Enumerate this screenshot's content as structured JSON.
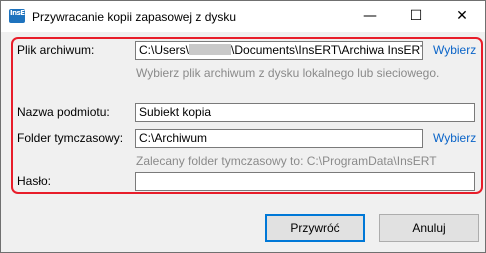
{
  "window": {
    "title": "Przywracanie kopii zapasowej z dysku",
    "icon_text": "InsERT",
    "controls": {
      "minimize": "—",
      "maximize": "☐",
      "close": "✕"
    }
  },
  "form": {
    "archive": {
      "label": "Plik archiwum:",
      "value_prefix": "C:\\Users\\",
      "value_suffix": "\\Documents\\InsERT\\Archiwa InsERT",
      "browse": "Wybierz",
      "hint": "Wybierz plik archiwum z dysku lokalnego lub sieciowego."
    },
    "entity": {
      "label": "Nazwa podmiotu:",
      "value": "Subiekt kopia"
    },
    "temp_folder": {
      "label": "Folder tymczasowy:",
      "value": "C:\\Archiwum",
      "browse": "Wybierz",
      "hint": "Zalecany folder tymczasowy to: C:\\ProgramData\\InsERT"
    },
    "password": {
      "label": "Hasło:",
      "value": ""
    }
  },
  "buttons": {
    "restore": "Przywróć",
    "cancel": "Anuluj"
  },
  "colors": {
    "highlight_frame": "#e81d2a",
    "link": "#0a64c8",
    "focus": "#0078d7"
  }
}
